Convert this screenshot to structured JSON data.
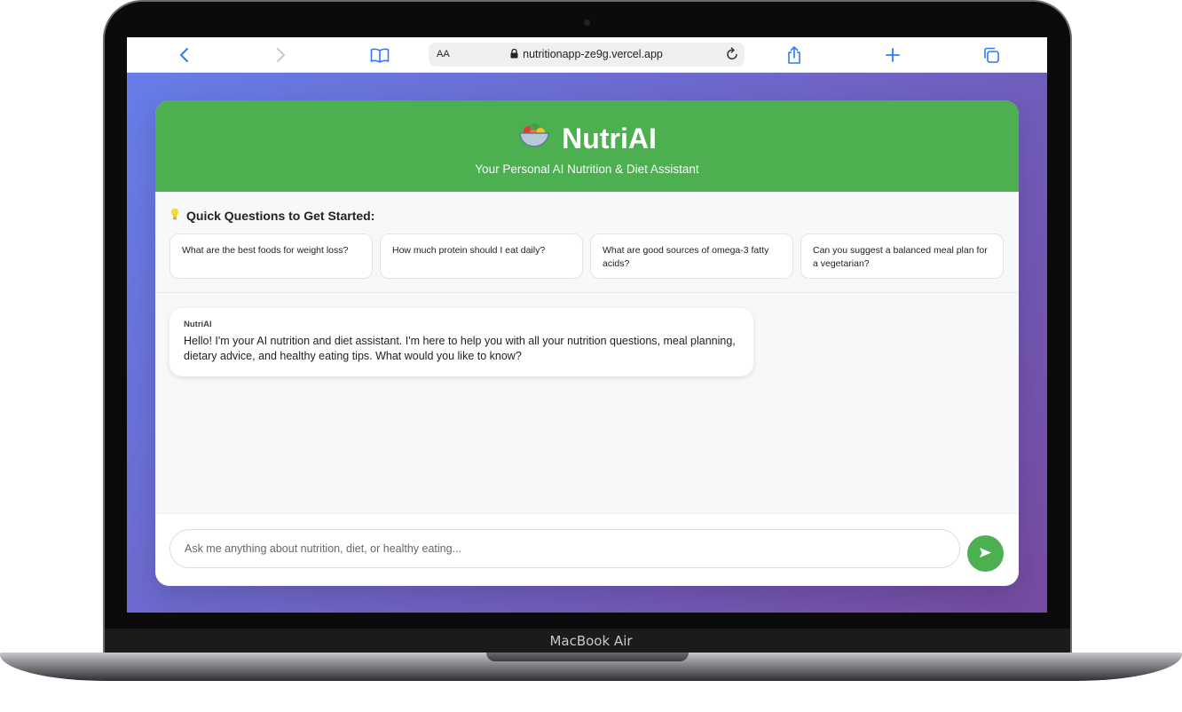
{
  "device": {
    "label": "MacBook Air"
  },
  "browser": {
    "text_size_label": "AA",
    "url": "nutritionapp-ze9g.vercel.app",
    "icons": [
      "back-chevron-icon",
      "forward-chevron-icon",
      "bookmarks-book-icon",
      "lock-icon",
      "reload-icon",
      "share-icon",
      "plus-icon",
      "tabs-icon"
    ]
  },
  "app": {
    "header": {
      "icon": "salad-bowl-icon",
      "title": "NutriAI",
      "subtitle": "Your Personal AI Nutrition & Diet Assistant"
    },
    "quick_questions": {
      "icon": "lightbulb-icon",
      "title": "Quick Questions to Get Started:",
      "items": [
        "What are the best foods for weight loss?",
        "How much protein should I eat daily?",
        "What are good sources of omega-3 fatty acids?",
        "Can you suggest a balanced meal plan for a vegetarian?"
      ]
    },
    "messages": [
      {
        "sender": "NutriAI",
        "text": "Hello! I'm your AI nutrition and diet assistant. I'm here to help you with all your nutrition questions, meal planning, dietary advice, and healthy eating tips. What would you like to know?"
      }
    ],
    "composer": {
      "placeholder": "Ask me anything about nutrition, diet, or healthy eating...",
      "value": "",
      "send_icon": "send-arrow-icon"
    }
  },
  "colors": {
    "header_green": "#4caf50",
    "bg_gradient_start": "#667eea",
    "bg_gradient_end": "#764ba2",
    "browser_accent": "#2f7bf5"
  }
}
